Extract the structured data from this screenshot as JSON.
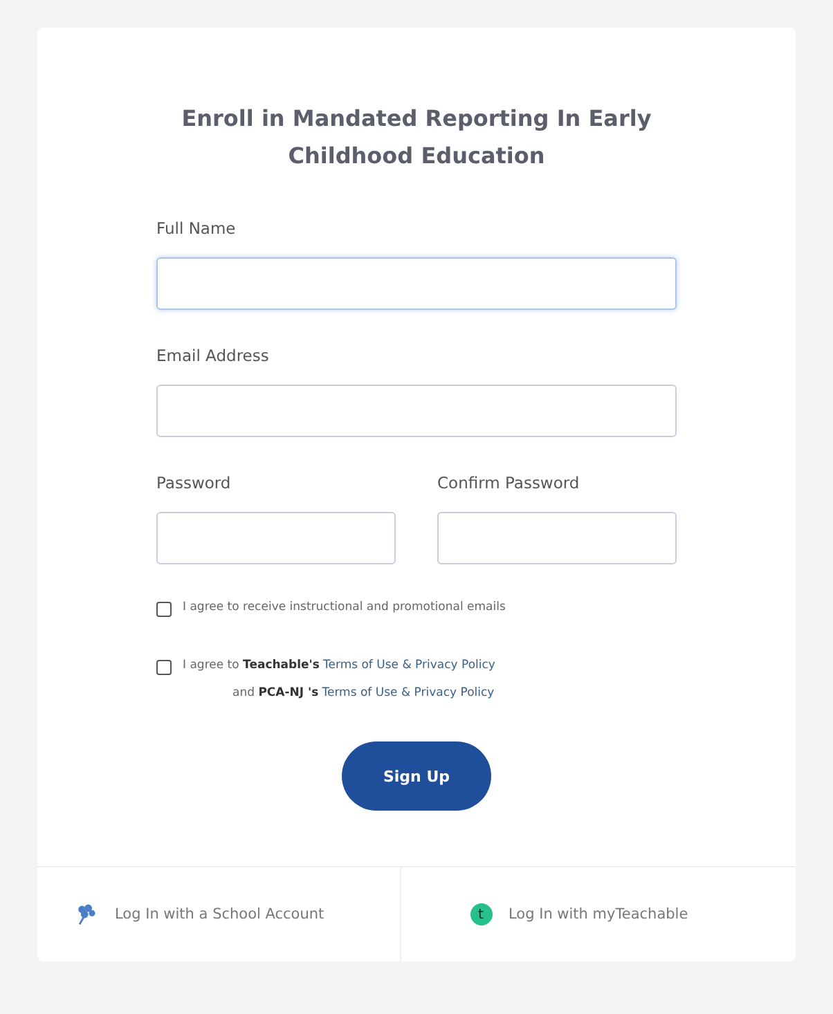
{
  "title": "Enroll in Mandated Reporting In Early Childhood Education",
  "field_rows": [
    [
      {
        "label": "Full Name",
        "focused": true
      }
    ],
    [
      {
        "label": "Email Address",
        "focused": false
      }
    ],
    [
      {
        "label": "Password",
        "focused": false
      },
      {
        "label": "Confirm Password",
        "focused": false
      }
    ]
  ],
  "consents": [
    {
      "checked": false,
      "lines": [
        [
          {
            "kind": "text",
            "text": "I agree to receive instructional and promotional emails"
          }
        ]
      ]
    },
    {
      "checked": false,
      "lines": [
        [
          {
            "kind": "text",
            "text": "I agree to "
          },
          {
            "kind": "bold",
            "text": "Teachable's"
          },
          {
            "kind": "link",
            "text": "Terms of Use & Privacy Policy"
          }
        ],
        [
          {
            "kind": "text",
            "text": "and "
          },
          {
            "kind": "bold",
            "text": "PCA-NJ 's"
          },
          {
            "kind": "link",
            "text": "Terms of Use & Privacy Policy"
          }
        ]
      ]
    }
  ],
  "submit": "Sign Up",
  "logins": [
    {
      "kind": "school",
      "label": "Log In with a School Account"
    },
    {
      "kind": "teachable",
      "label": "Log In with myTeachable",
      "icon_text": "t"
    }
  ]
}
